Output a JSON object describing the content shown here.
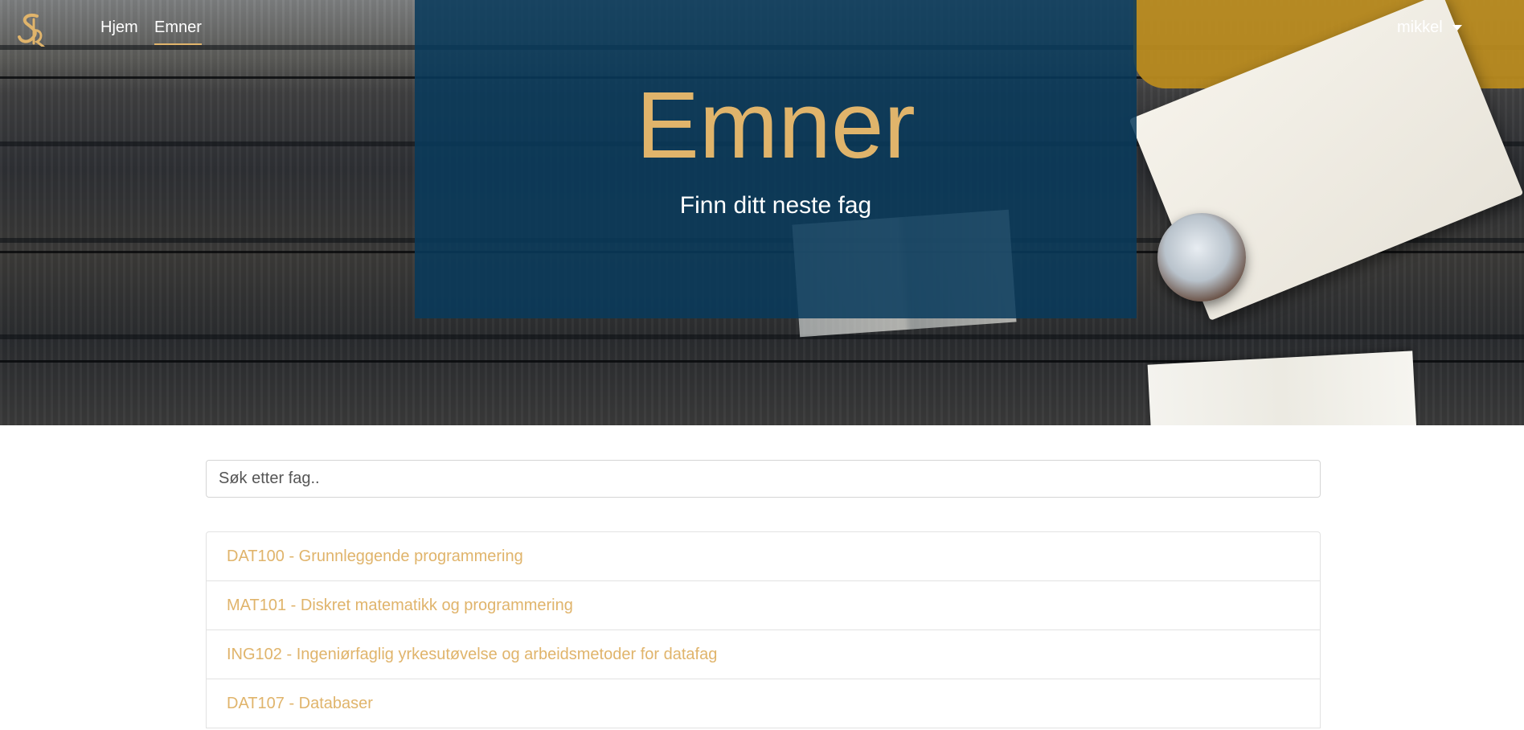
{
  "nav": {
    "logo_icon": "sr-monogram-logo",
    "links": [
      {
        "label": "Hjem",
        "active": false
      },
      {
        "label": "Emner",
        "active": true
      }
    ],
    "user": {
      "name": "mikkel",
      "icon": "caret-down-icon"
    }
  },
  "hero": {
    "title": "Emner",
    "subtitle": "Finn ditt neste fag"
  },
  "search": {
    "placeholder": "Søk etter fag..",
    "value": ""
  },
  "courses": [
    {
      "label": "DAT100 - Grunnleggende programmering"
    },
    {
      "label": "MAT101 - Diskret matematikk og programmering"
    },
    {
      "label": "ING102 - Ingeniørfaglig yrkesutøvelse og arbeidsmetoder for datafag"
    },
    {
      "label": "DAT107 - Databaser"
    }
  ],
  "colors": {
    "accent": "#e0b46b",
    "overlay": "#083a5c",
    "border": "#e2e2e2"
  }
}
